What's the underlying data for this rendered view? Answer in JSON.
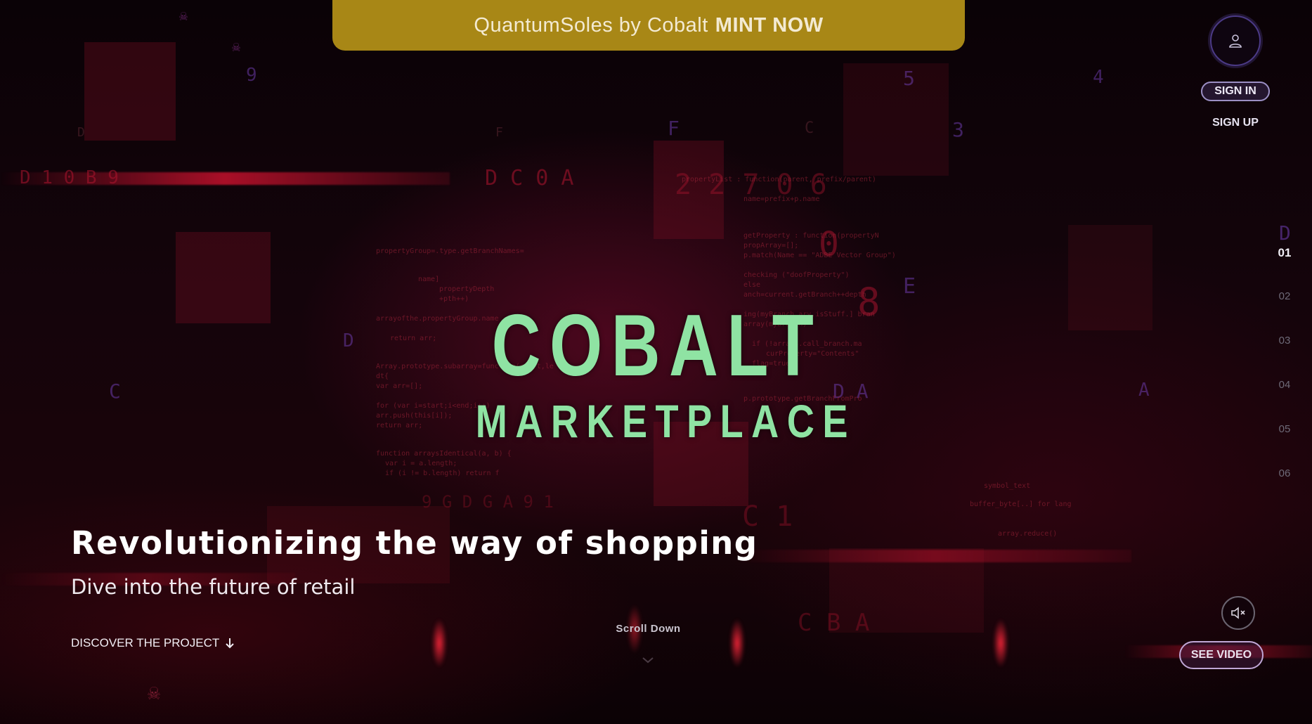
{
  "banner": {
    "brand_text": "QuantumSoles by Cobalt",
    "cta_text": "MINT NOW",
    "color": "#a88716"
  },
  "account": {
    "avatar_icon": "user-icon",
    "sign_in_label": "SIGN IN",
    "sign_up_label": "SIGN UP"
  },
  "section_nav": {
    "items": [
      "01",
      "02",
      "03",
      "04",
      "05",
      "06"
    ],
    "active": "01"
  },
  "hero": {
    "logo_line1": "COBALT",
    "logo_line2": "MARKETPLACE",
    "logo_color": "#8fe3a3",
    "headline": "Revolutionizing the way of shopping",
    "subheadline": "Dive into the future of retail",
    "discover_label": "DISCOVER THE PROJECT",
    "discover_icon": "arrow-down-icon",
    "scroll_label": "Scroll Down",
    "scroll_icon": "chevron-down-icon"
  },
  "media_controls": {
    "mute_icon": "speaker-muted-icon",
    "see_video_label": "SEE VIDEO"
  },
  "colors": {
    "background": "#070205",
    "accent_red": "#b0152f",
    "accent_purple": "#6a3aa8"
  }
}
